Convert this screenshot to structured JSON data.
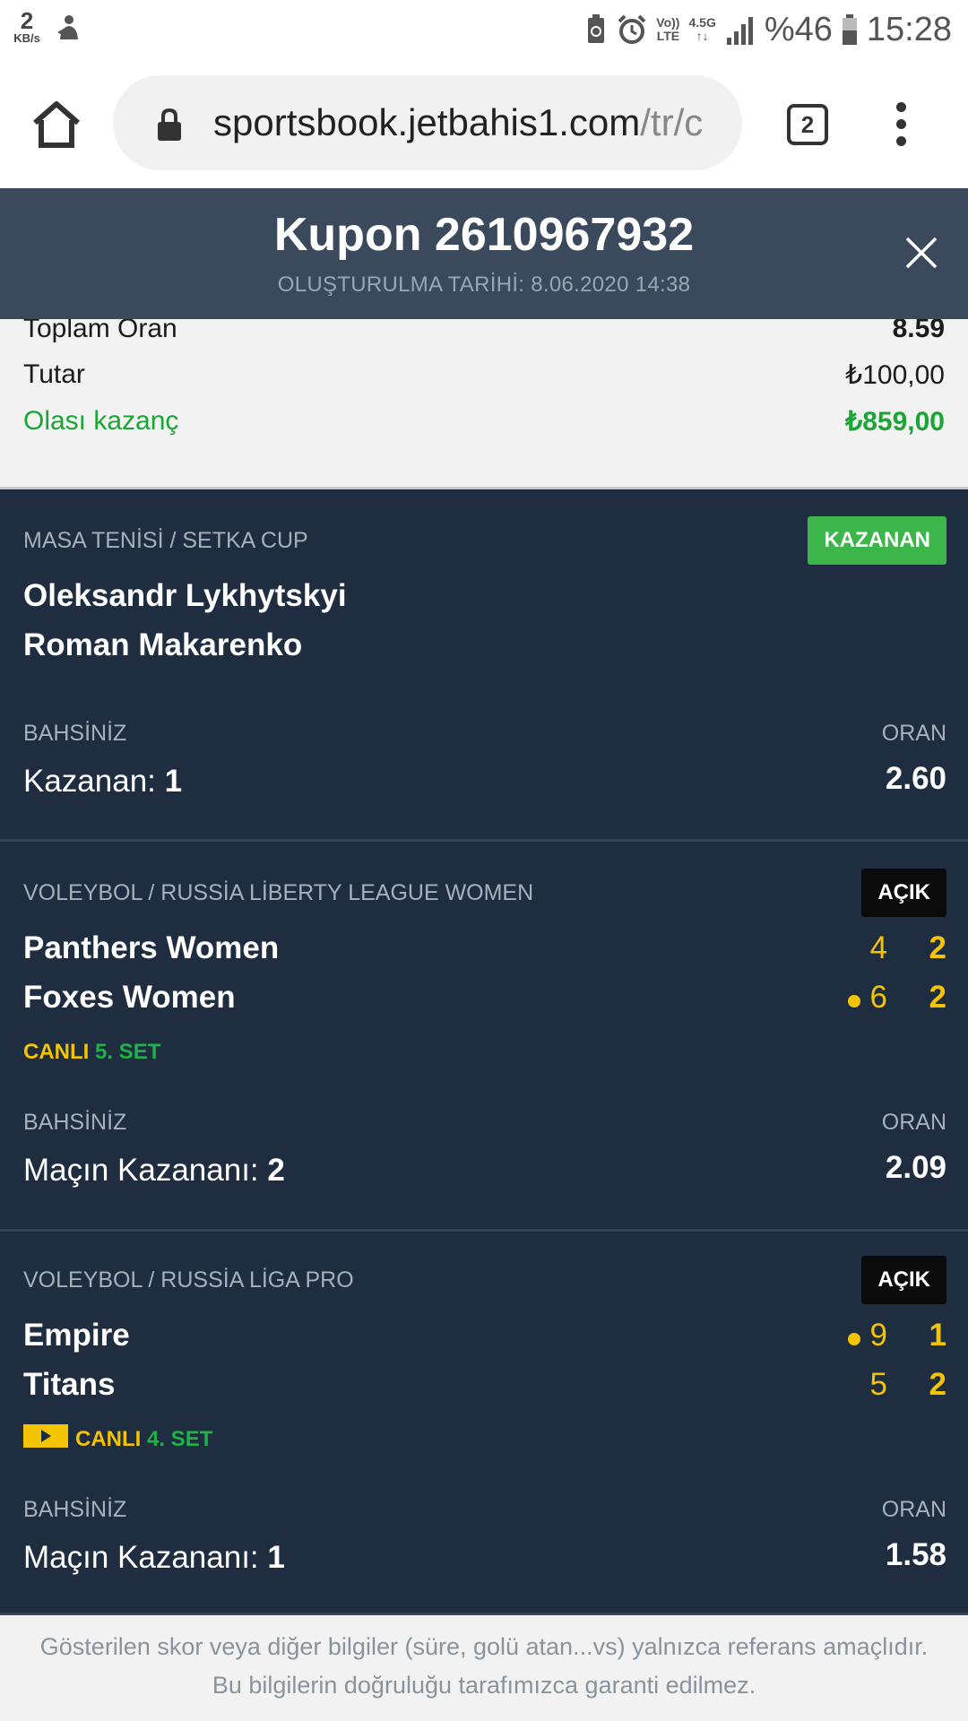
{
  "status_bar": {
    "net_speed_value": "2",
    "net_speed_unit": "KB/s",
    "volte_top": "Vo))",
    "volte_bottom": "LTE",
    "network_top": "4.5G",
    "network_bottom": "↑↓",
    "battery": "%46",
    "time": "15:28"
  },
  "browser": {
    "url_main": "sportsbook.jetbahis1.com",
    "url_rest": "/tr/c",
    "tab_count": "2"
  },
  "coupon": {
    "title": "Kupon 2610967932",
    "created": "OLUŞTURULMA TARİHİ: 8.06.2020 14:38"
  },
  "summary": {
    "total_odds_label": "Toplam Oran",
    "total_odds_value": "8.59",
    "stake_label": "Tutar",
    "stake_value": "₺100,00",
    "potential_win_label": "Olası kazanç",
    "potential_win_value": "₺859,00"
  },
  "bets": [
    {
      "league": "MASA TENİSİ / SETKA CUP",
      "status": "KAZANAN",
      "team1": "Oleksandr Lykhytskyi",
      "team2": "Roman Makarenko",
      "bet_label": "BAHSİNİZ",
      "odds_label": "ORAN",
      "pick_market": "Kazanan: ",
      "pick_value": "1",
      "odds": "2.60"
    },
    {
      "league": "VOLEYBOL / RUSSİA LİBERTY LEAGUE WOMEN",
      "status": "AÇIK",
      "team1": "Panthers Women",
      "team2": "Foxes Women",
      "team1_points": "4",
      "team1_sets": "2",
      "team2_points": "6",
      "team2_sets": "2",
      "live_label": "CANLI",
      "live_period": "5. SET",
      "bet_label": "BAHSİNİZ",
      "odds_label": "ORAN",
      "pick_market": "Maçın Kazananı: ",
      "pick_value": "2",
      "odds": "2.09"
    },
    {
      "league": "VOLEYBOL / RUSSİA LİGA PRO",
      "status": "AÇIK",
      "team1": "Empire",
      "team2": "Titans",
      "team1_points": "9",
      "team1_sets": "1",
      "team2_points": "5",
      "team2_sets": "2",
      "live_label": "CANLI",
      "live_period": "4. SET",
      "bet_label": "BAHSİNİZ",
      "odds_label": "ORAN",
      "pick_market": "Maçın Kazananı: ",
      "pick_value": "1",
      "odds": "1.58"
    }
  ],
  "footer": {
    "line1": "Gösterilen skor veya diğer bilgiler (süre, golü atan...vs) yalnızca referans amaçlıdır.",
    "line2": "Bu bilgilerin doğruluğu tarafımızca garanti edilmez."
  },
  "colors": {
    "card_bg": "#1f2d40",
    "header_bg": "#3a4a5c",
    "won_badge": "#3cb54a",
    "open_badge": "#0b0b0b",
    "live_yellow": "#f5c400",
    "set_green": "#22b04a",
    "win_green": "#1aa534"
  },
  "icons": [
    "data-saver-icon",
    "recycle-icon",
    "alarm-icon",
    "signal-icon",
    "battery-icon",
    "home-icon",
    "lock-icon",
    "menu-dots-icon",
    "close-icon",
    "serving-dot-icon",
    "live-tv-icon"
  ]
}
